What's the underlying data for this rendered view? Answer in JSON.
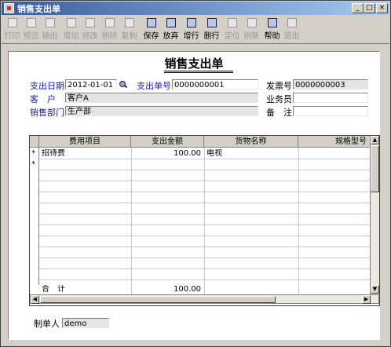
{
  "window": {
    "title": "销售支出单",
    "min": "_",
    "max": "□",
    "close": "×"
  },
  "toolbar": [
    {
      "label": "打印",
      "icon": "printer-icon",
      "enabled": false
    },
    {
      "label": "预览",
      "icon": "preview-icon",
      "enabled": false
    },
    {
      "label": "输出",
      "icon": "export-icon",
      "enabled": false
    },
    {
      "label": "增加",
      "icon": "add-icon",
      "enabled": false
    },
    {
      "label": "修改",
      "icon": "edit-icon",
      "enabled": false
    },
    {
      "label": "删除",
      "icon": "delete-icon",
      "enabled": false
    },
    {
      "label": "复制",
      "icon": "copy-icon",
      "enabled": false
    },
    {
      "label": "保存",
      "icon": "save-icon",
      "enabled": true
    },
    {
      "label": "放弃",
      "icon": "undo-icon",
      "enabled": true
    },
    {
      "label": "增行",
      "icon": "insert-row-icon",
      "enabled": true
    },
    {
      "label": "删行",
      "icon": "delete-row-icon",
      "enabled": true
    },
    {
      "label": "定位",
      "icon": "locate-icon",
      "enabled": false
    },
    {
      "label": "刷新",
      "icon": "refresh-icon",
      "enabled": false
    },
    {
      "label": "帮助",
      "icon": "help-icon",
      "enabled": true
    },
    {
      "label": "退出",
      "icon": "exit-icon",
      "enabled": false
    }
  ],
  "form": {
    "title": "销售支出单",
    "date_label": "支出日期",
    "date_value": "2012-01-01",
    "no_label": "支出单号",
    "no_value": "0000000001",
    "invoice_label": "发票号",
    "invoice_value": "0000000003",
    "customer_label": "客　户",
    "customer_value": "客户A",
    "salesman_label": "业务员",
    "salesman_value": "",
    "dept_label": "销售部门",
    "dept_value": "生产部",
    "note_label": "备　注",
    "note_value": ""
  },
  "grid": {
    "columns": [
      "费用项目",
      "支出金额",
      "货物名称",
      "规格型号"
    ],
    "rows": [
      {
        "marker": "*",
        "item": "招待费",
        "amount": "100.00",
        "goods": "电视",
        "spec": ""
      },
      {
        "marker": "*",
        "item": "",
        "amount": "",
        "goods": "",
        "spec": ""
      }
    ],
    "total_label": "合　计",
    "total_amount": "100.00"
  },
  "footer": {
    "maker_label": "制单人",
    "maker_value": "demo"
  }
}
